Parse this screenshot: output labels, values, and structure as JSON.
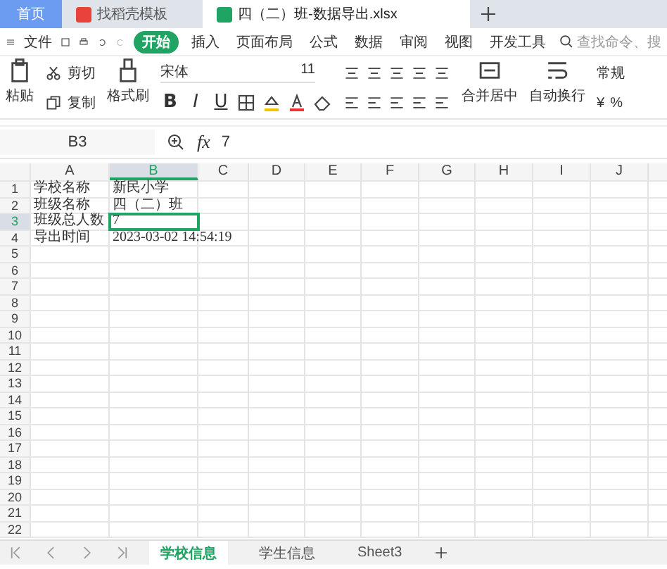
{
  "browser_tabs": [
    {
      "label": "首页",
      "kind": "home",
      "selected": false
    },
    {
      "label": "找稻壳模板",
      "kind": "app",
      "selected": false
    },
    {
      "label": "四（二）班-数据导出.xlsx",
      "kind": "doc",
      "selected": true
    }
  ],
  "menu": {
    "file": "文件",
    "tabs": [
      {
        "label": "开始",
        "selected": true
      },
      {
        "label": "插入",
        "selected": false
      },
      {
        "label": "页面布局",
        "selected": false
      },
      {
        "label": "公式",
        "selected": false
      },
      {
        "label": "数据",
        "selected": false
      },
      {
        "label": "审阅",
        "selected": false
      },
      {
        "label": "视图",
        "selected": false
      },
      {
        "label": "开发工具",
        "selected": false
      }
    ],
    "search_placeholder": "查找命令、搜"
  },
  "ribbon": {
    "paste": "粘贴",
    "cut": "剪切",
    "copy": "复制",
    "format_painter": "格式刷",
    "font": "宋体",
    "size": "11",
    "format_buttons": [
      "B",
      "I",
      "U"
    ],
    "merge": "合并居中",
    "wrap": "自动换行",
    "number_format": "常规",
    "currency": "¥",
    "percent": "%"
  },
  "formula_bar": {
    "cell_ref": "B3",
    "fx": "fx",
    "value": "7"
  },
  "columns": [
    {
      "label": "A",
      "selected": false
    },
    {
      "label": "B",
      "selected": true
    },
    {
      "label": "C",
      "selected": false
    },
    {
      "label": "D",
      "selected": false
    },
    {
      "label": "E",
      "selected": false
    },
    {
      "label": "F",
      "selected": false
    },
    {
      "label": "G",
      "selected": false
    },
    {
      "label": "H",
      "selected": false
    },
    {
      "label": "I",
      "selected": false
    },
    {
      "label": "J",
      "selected": false
    }
  ],
  "rows": [
    {
      "number": "1",
      "selected": false,
      "cells": [
        "学校名称",
        "新民小学"
      ]
    },
    {
      "number": "2",
      "selected": false,
      "cells": [
        "班级名称",
        "四（二）班"
      ]
    },
    {
      "number": "3",
      "selected": true,
      "cells": [
        "班级总人数",
        "7"
      ]
    },
    {
      "number": "4",
      "selected": false,
      "cells": [
        "导出时间",
        "2023-03-02 14:54:19"
      ]
    },
    {
      "number": "5",
      "selected": false
    },
    {
      "number": "6",
      "selected": false
    },
    {
      "number": "7",
      "selected": false
    },
    {
      "number": "8",
      "selected": false
    },
    {
      "number": "9",
      "selected": false
    },
    {
      "number": "10",
      "selected": false
    },
    {
      "number": "11",
      "selected": false
    },
    {
      "number": "12",
      "selected": false
    },
    {
      "number": "13",
      "selected": false
    },
    {
      "number": "14",
      "selected": false
    },
    {
      "number": "15",
      "selected": false
    },
    {
      "number": "16",
      "selected": false
    },
    {
      "number": "17",
      "selected": false
    },
    {
      "number": "18",
      "selected": false
    },
    {
      "number": "19",
      "selected": false
    },
    {
      "number": "20",
      "selected": false
    },
    {
      "number": "21",
      "selected": false
    },
    {
      "number": "22",
      "selected": false
    }
  ],
  "sheets": [
    {
      "label": "学校信息",
      "selected": true
    },
    {
      "label": "学生信息",
      "selected": false
    },
    {
      "label": "Sheet3",
      "selected": false
    }
  ]
}
